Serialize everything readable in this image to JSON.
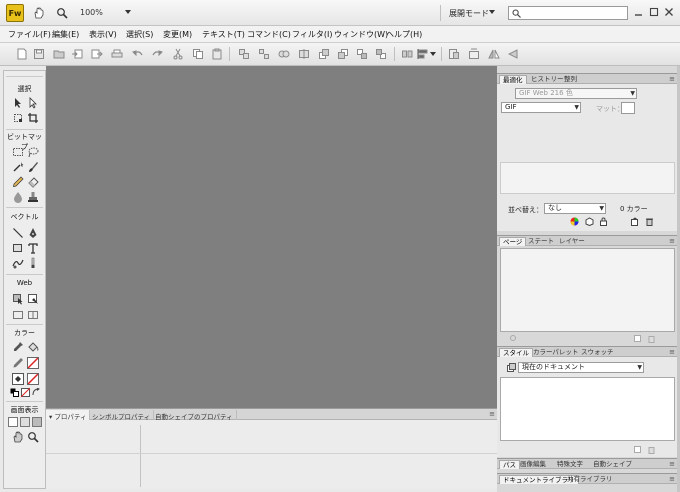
{
  "titlebar": {
    "logo": "Fw",
    "zoom": "100%",
    "workspace": "展開モード"
  },
  "menu": [
    "ファイル(F)",
    "編集(E)",
    "表示(V)",
    "選択(S)",
    "変更(M)",
    "テキスト(T)",
    "コマンド(C)",
    "フィルタ(I)",
    "ウィンドウ(W)",
    "ヘルプ(H)"
  ],
  "tools": {
    "select": "選択",
    "bitmap": "ビットマップ",
    "vector": "ベクトル",
    "web": "Web",
    "colors": "カラー",
    "view": "画面表示"
  },
  "properties": {
    "tabs": [
      "プロパティ",
      "シンボルプロパティ",
      "自動シェイプのプロパティ"
    ]
  },
  "optimize": {
    "tabs": [
      "最適化",
      "ヒストリー",
      "整列"
    ],
    "palette": "GIF Web 216 色",
    "format": "GIF",
    "matte_label": "マット：",
    "sort_label": "並べ替え：",
    "sort_value": "なし",
    "color_count": "0 カラー"
  },
  "pages_panel": {
    "tabs": [
      "ページ",
      "ステート",
      "レイヤー"
    ]
  },
  "styles_panel": {
    "tabs": [
      "スタイル",
      "カラーパレット",
      "スウォッチ"
    ],
    "current": "現在のドキュメント"
  },
  "bottom_tabs_1": [
    "パス",
    "画像編集",
    "特殊文字",
    "自動シェイプ"
  ],
  "bottom_tabs_2": [
    "ドキュメントライブラリ",
    "共有ライブラリ"
  ],
  "colors": {
    "accent": "#e8c21b",
    "canvas": "#7f7f7f"
  }
}
